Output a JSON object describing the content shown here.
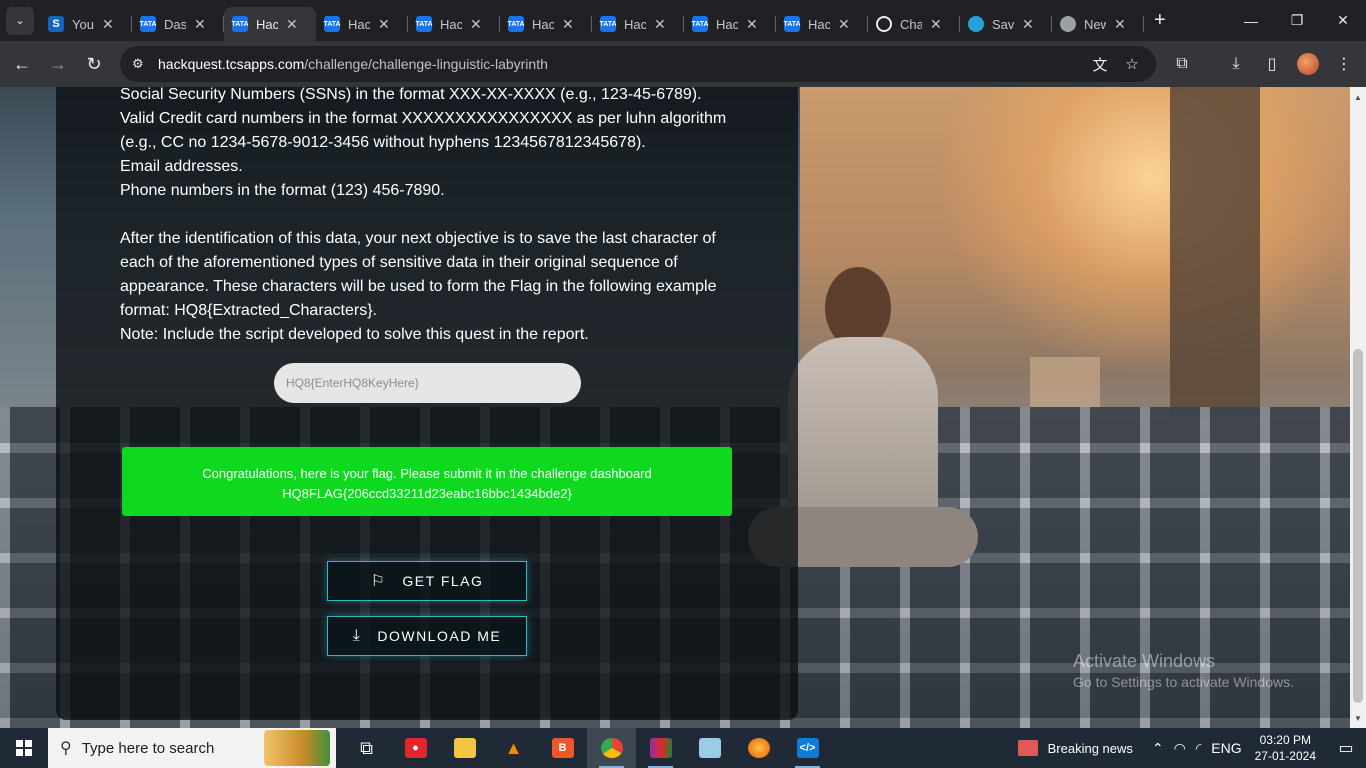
{
  "browser": {
    "tabs": [
      {
        "label": "You",
        "favicon": "S",
        "type": "s"
      },
      {
        "label": "Dash",
        "favicon": "TATA",
        "type": "tata"
      },
      {
        "label": "Hack",
        "favicon": "TATA",
        "type": "tata",
        "active": true
      },
      {
        "label": "Hack",
        "favicon": "TATA",
        "type": "tata"
      },
      {
        "label": "Hack",
        "favicon": "TATA",
        "type": "tata"
      },
      {
        "label": "Hack",
        "favicon": "TATA",
        "type": "tata"
      },
      {
        "label": "Hack",
        "favicon": "TATA",
        "type": "tata"
      },
      {
        "label": "Hack",
        "favicon": "TATA",
        "type": "tata"
      },
      {
        "label": "Hack",
        "favicon": "TATA",
        "type": "tata"
      },
      {
        "label": "Chat",
        "favicon": "",
        "type": "chat"
      },
      {
        "label": "Save",
        "favicon": "",
        "type": "tg"
      },
      {
        "label": "New",
        "favicon": "",
        "type": "chrome"
      }
    ],
    "url_host": "hackquest.tcsapps.com",
    "url_path": "/challenge/challenge-linguistic-labyrinth"
  },
  "page": {
    "lines_block1": [
      "Social Security Numbers (SSNs) in the format XXX-XX-XXXX (e.g., 123-45-6789).",
      "Valid Credit card numbers in the format XXXXXXXXXXXXXXXX as per luhn algorithm",
      "(e.g., CC no 1234-5678-9012-3456 without hyphens 1234567812345678).",
      "Email addresses.",
      "Phone numbers in the format (123) 456-7890."
    ],
    "lines_block2": [
      "After the identification of this data, your next objective is to save the last character of",
      "each of the aforementioned types of sensitive data in their original sequence of",
      "appearance. These characters will be used to form the Flag in the following example",
      "format: HQ8{Extracted_Characters}.",
      "Note: Include the script developed to solve this quest in the report."
    ],
    "flag_input_placeholder": "HQ8{EnterHQ8KeyHere}",
    "success_line1": "Congratulations, here is your flag. Please submit it in the challenge dashboard",
    "success_line2": "HQ8FLAG{206ccd33211d23eabc16bbc1434bde2}",
    "get_flag_label": "GET FLAG",
    "download_label": "DOWNLOAD ME",
    "activate_title": "Activate Windows",
    "activate_sub": "Go to Settings to activate Windows.",
    "success_color": "#0fd91f",
    "button_border_color": "#2fb7c9"
  },
  "taskbar": {
    "search_placeholder": "Type here to search",
    "news_label": "Breaking news",
    "lang": "ENG",
    "time": "03:20 PM",
    "date": "27-01-2024"
  }
}
